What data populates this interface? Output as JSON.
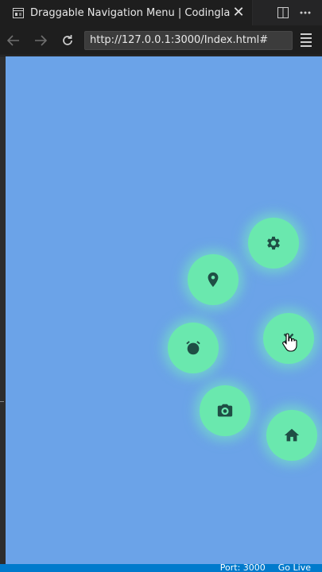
{
  "window": {
    "tab_title": "Draggable Navigation Menu | Codinglab",
    "tab_close": "✕"
  },
  "toolbar": {
    "url": "http://127.0.0.1:3000/Index.html#"
  },
  "status_bar": {
    "port": "Port: 3000",
    "go_live": "Go Live"
  },
  "nav_menu": {
    "items": [
      {
        "name": "settings",
        "icon": "gear-icon"
      },
      {
        "name": "location",
        "icon": "location-pin-icon"
      },
      {
        "name": "alarm",
        "icon": "alarm-clock-icon"
      },
      {
        "name": "toggle",
        "icon": "close-icon"
      },
      {
        "name": "camera",
        "icon": "camera-icon"
      },
      {
        "name": "home",
        "icon": "home-icon"
      }
    ]
  },
  "colors": {
    "page_background": "#6ba3e8",
    "nav_button": "#6ae8ae",
    "icon": "#1f4e45",
    "status_bar": "#007acc"
  }
}
